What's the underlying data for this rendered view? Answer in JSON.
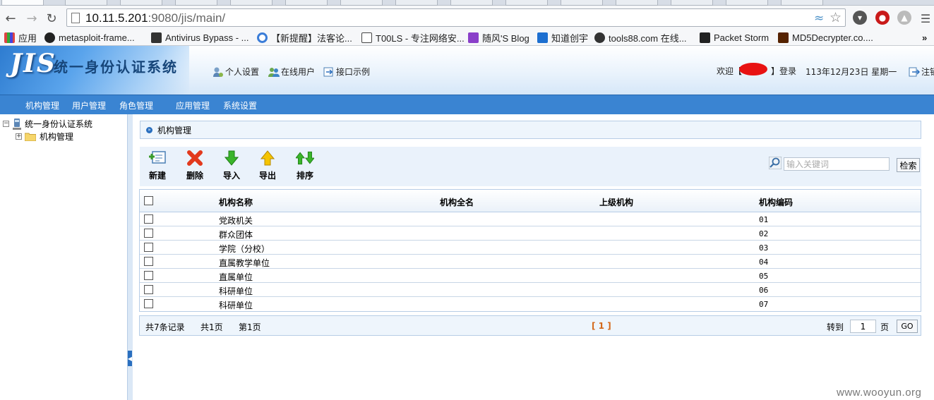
{
  "browser": {
    "url_host": "10.11.5.201",
    "url_rest": ":9080/jis/main/",
    "bookmarks": [
      {
        "label": "应用",
        "color": "#d44"
      },
      {
        "label": "metasploit-frame...",
        "color": "#222"
      },
      {
        "label": "Antivirus Bypass - ...",
        "color": "#333"
      },
      {
        "label": "【新提醒】法客论...",
        "color": "#3b7dd8"
      },
      {
        "label": "T00LS - 专注网络安...",
        "color": "#444"
      },
      {
        "label": "随风'S Blog",
        "color": "#8a3fc9"
      },
      {
        "label": "知道创宇",
        "color": "#1d6fd0"
      },
      {
        "label": "tools88.com 在线...",
        "color": "#333"
      },
      {
        "label": "Packet Storm",
        "color": "#222"
      },
      {
        "label": "MD5Decrypter.co....",
        "color": "#552200"
      }
    ]
  },
  "header": {
    "logo": "JIS",
    "system_title": "统一身份认证系统",
    "links": [
      "个人设置",
      "在线用户",
      "接口示例"
    ],
    "welcome_prefix": "欢迎【",
    "welcome_suffix": "】登录",
    "date": "113年12月23日 星期一",
    "logout": "注销"
  },
  "nav": [
    "机构管理",
    "用户管理",
    "角色管理",
    "应用管理",
    "系统设置"
  ],
  "tree": {
    "root": "统一身份认证系统",
    "child": "机构管理"
  },
  "content": {
    "title": "机构管理",
    "actions": [
      "新建",
      "删除",
      "导入",
      "导出",
      "排序"
    ],
    "search_placeholder": "输入关键词",
    "search_button": "检索",
    "columns": [
      "机构名称",
      "机构全名",
      "上级机构",
      "机构编码"
    ],
    "rows": [
      {
        "name": "党政机关",
        "fullname": "",
        "parent": "",
        "code": "01"
      },
      {
        "name": "群众团体",
        "fullname": "",
        "parent": "",
        "code": "02"
      },
      {
        "name": "学院（分校）",
        "fullname": "",
        "parent": "",
        "code": "03"
      },
      {
        "name": "直属教学单位",
        "fullname": "",
        "parent": "",
        "code": "04"
      },
      {
        "name": "直属单位",
        "fullname": "",
        "parent": "",
        "code": "05"
      },
      {
        "name": "科研单位",
        "fullname": "",
        "parent": "",
        "code": "06"
      },
      {
        "name": "科研单位",
        "fullname": "",
        "parent": "",
        "code": "07"
      }
    ],
    "pager": {
      "total": "共7条记录",
      "pages": "共1页",
      "current": "第1页",
      "indicator": "[ 1 ]",
      "goto_label": "转到",
      "goto_value": "1",
      "page_unit": "页",
      "go": "GO"
    }
  },
  "watermark": "www.wooyun.org"
}
